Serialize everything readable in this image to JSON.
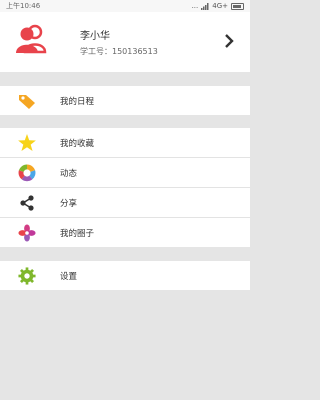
{
  "status": {
    "time": "上午10:46",
    "network": "4G+",
    "dots": "...",
    "signal_icon": "signal-icon",
    "battery_icon": "battery-icon"
  },
  "profile": {
    "name": "李小华",
    "employee_id": "学工号：150136513",
    "avatar_icon": "users-icon",
    "chevron_icon": "chevron-right-icon",
    "avatar_color": "#e8434b"
  },
  "menu": {
    "group1": [
      {
        "label": "我的日程",
        "icon": "tag-icon",
        "color": "#f5a623"
      }
    ],
    "group2": [
      {
        "label": "我的收藏",
        "icon": "star-icon",
        "color": "#f7d31a"
      },
      {
        "label": "动态",
        "icon": "aperture-icon",
        "color": "#4aa6e8"
      },
      {
        "label": "分享",
        "icon": "share-icon",
        "color": "#333333"
      },
      {
        "label": "我的圈子",
        "icon": "circle-flower-icon",
        "color": "#d23c84"
      }
    ],
    "group3": [
      {
        "label": "设置",
        "icon": "gear-icon",
        "color": "#7fb72c"
      }
    ]
  }
}
